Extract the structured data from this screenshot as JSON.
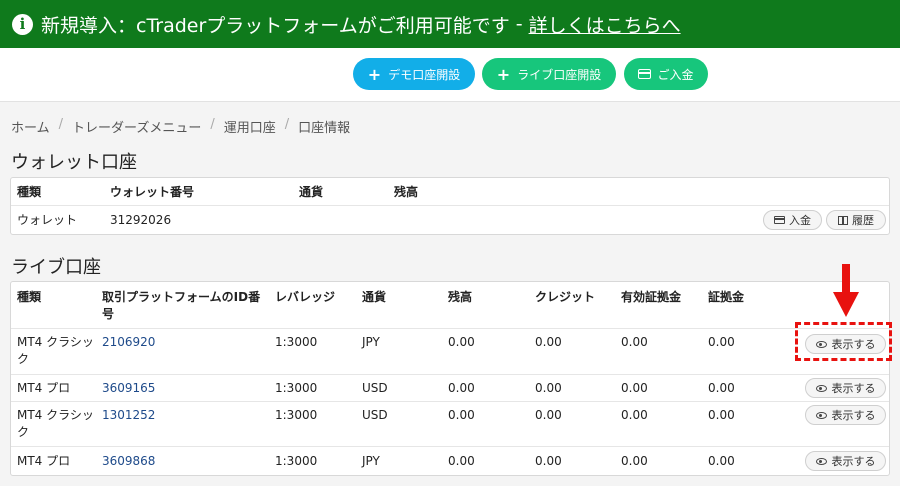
{
  "banner": {
    "text": "新規導入：cTraderプラットフォームがご利用可能です",
    "separator": "-",
    "link": "詳しくはこちらへ"
  },
  "topbar": {
    "demo_button": "デモ口座開設",
    "live_button": "ライブ口座開設",
    "deposit_button": "ご入金"
  },
  "breadcrumb": [
    "ホーム",
    "トレーダーズメニュー",
    "運用口座",
    "口座情報"
  ],
  "wallet": {
    "title": "ウォレット口座",
    "headers": [
      "種類",
      "ウォレット番号",
      "通貨",
      "残高"
    ],
    "row": {
      "type": "ウォレット",
      "number": "31292026"
    },
    "deposit_label": "入金",
    "history_label": "履歴"
  },
  "live": {
    "title": "ライブ口座",
    "headers": [
      "種類",
      "取引プラットフォームのID番号",
      "レバレッジ",
      "通貨",
      "残高",
      "クレジット",
      "有効証拠金",
      "証拠金"
    ],
    "show_label": "表示する",
    "rows": [
      {
        "type": "MT4 クラシック",
        "id": "2106920",
        "leverage": "1:3000",
        "currency": "JPY",
        "balance": "0.00",
        "credit": "0.00",
        "equity": "0.00",
        "margin": "0.00"
      },
      {
        "type": "MT4 プロ",
        "id": "3609165",
        "leverage": "1:3000",
        "currency": "USD",
        "balance": "0.00",
        "credit": "0.00",
        "equity": "0.00",
        "margin": "0.00"
      },
      {
        "type": "MT4 クラシック",
        "id": "1301252",
        "leverage": "1:3000",
        "currency": "USD",
        "balance": "0.00",
        "credit": "0.00",
        "equity": "0.00",
        "margin": "0.00"
      },
      {
        "type": "MT4 プロ",
        "id": "3609868",
        "leverage": "1:3000",
        "currency": "JPY",
        "balance": "0.00",
        "credit": "0.00",
        "equity": "0.00",
        "margin": "0.00"
      }
    ]
  },
  "colors": {
    "banner": "#0f7a1c",
    "demo": "#12aee8",
    "live": "#17c67c",
    "annotation": "#e8120f"
  }
}
